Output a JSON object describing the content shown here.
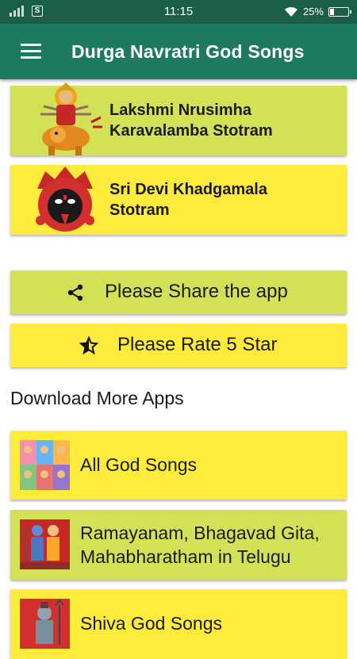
{
  "status_bar": {
    "time": "11:15",
    "battery": "25%",
    "battery_level": 0.25
  },
  "app_bar": {
    "title": "Durga Navratri God Songs"
  },
  "songs": [
    {
      "title_line1": "Lakshmi Nrusimha",
      "title_line2": "Karavalamba Stotram",
      "icon": "goddess-on-lion-image"
    },
    {
      "title_line1": "Sri Devi Khadgamala",
      "title_line2": "Stotram",
      "icon": "kali-face-image"
    }
  ],
  "actions": {
    "share": {
      "label": "Please Share the app",
      "icon": "share-icon"
    },
    "rate": {
      "label": "Please Rate 5 Star",
      "icon": "star-icon"
    }
  },
  "more_apps": {
    "heading": "Download More Apps",
    "items": [
      {
        "line1": "All God Songs",
        "line2": ""
      },
      {
        "line1": "Ramayanam, Bhagavad Gita,",
        "line2": "Mahabharatham in Telugu"
      },
      {
        "line1": "Shiva God Songs",
        "line2": ""
      }
    ]
  },
  "colors": {
    "status_bar": "#1b5e4a",
    "app_bar": "#1e7a5e",
    "card_green": "#d4e157",
    "card_yellow": "#ffeb3b"
  }
}
